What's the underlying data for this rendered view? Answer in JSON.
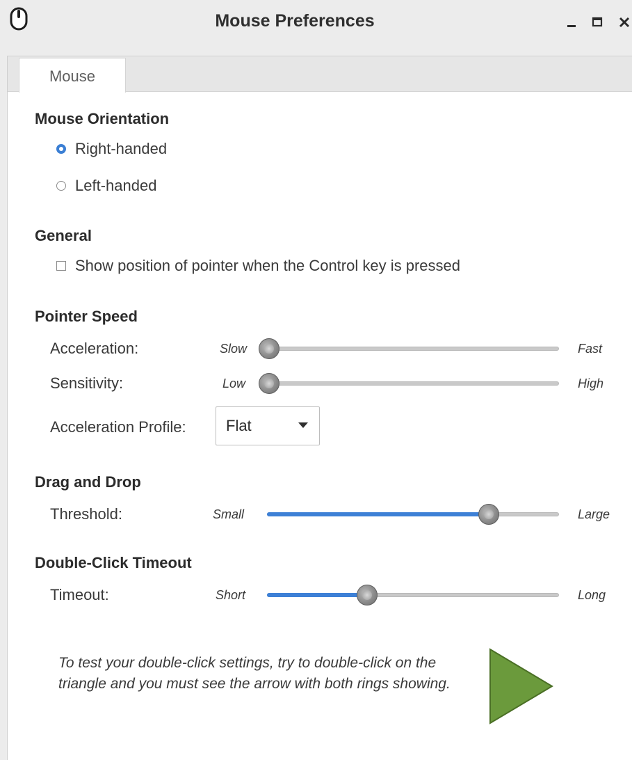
{
  "window": {
    "title": "Mouse Preferences",
    "controls": {
      "minimize": "minimize",
      "maximize": "maximize",
      "close": "close"
    }
  },
  "tabs": [
    {
      "label": "Mouse",
      "selected": true
    }
  ],
  "orientation": {
    "title": "Mouse Orientation",
    "options": [
      {
        "label": "Right-handed",
        "checked": true
      },
      {
        "label": "Left-handed",
        "checked": false
      }
    ]
  },
  "general": {
    "title": "General",
    "show_pointer_label": "Show position of pointer when the Control key is pressed",
    "show_pointer_checked": false
  },
  "pointer_speed": {
    "title": "Pointer Speed",
    "acceleration": {
      "label": "Acceleration:",
      "min_label": "Slow",
      "max_label": "Fast",
      "value": 0.0
    },
    "sensitivity": {
      "label": "Sensitivity:",
      "min_label": "Low",
      "max_label": "High",
      "value": 0.0
    },
    "profile": {
      "label": "Acceleration Profile:",
      "value": "Flat"
    }
  },
  "drag_drop": {
    "title": "Drag and Drop",
    "threshold": {
      "label": "Threshold:",
      "min_label": "Small",
      "max_label": "Large",
      "value": 0.78
    }
  },
  "double_click": {
    "title": "Double-Click Timeout",
    "timeout": {
      "label": "Timeout:",
      "min_label": "Short",
      "max_label": "Long",
      "value": 0.33
    },
    "hint": "To test your double-click settings, try to double-click on the triangle and you must see the arrow with both rings showing."
  },
  "colors": {
    "accent": "#3d80d6",
    "triangle_fill": "#6b9a3c",
    "triangle_stroke": "#4a6f25"
  }
}
